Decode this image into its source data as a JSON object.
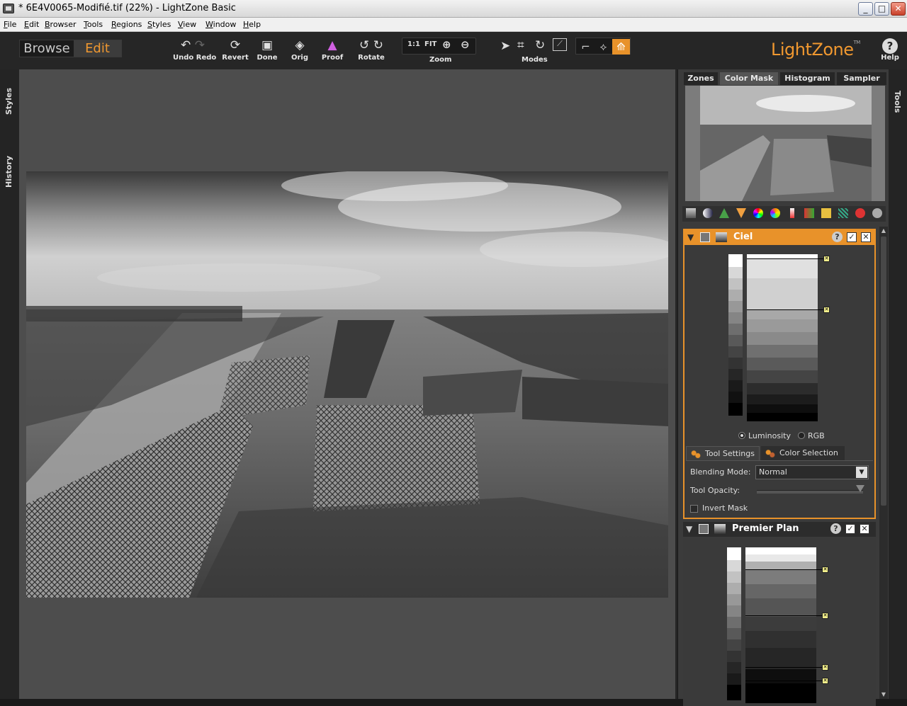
{
  "window": {
    "title": "* 6E4V0065-Modifié.tif (22%) - LightZone Basic",
    "minimize": "_",
    "maximize": "□",
    "close": "✕"
  },
  "menu": [
    "File",
    "Edit",
    "Browser",
    "Tools",
    "Regions",
    "Styles",
    "View",
    "Window",
    "Help"
  ],
  "mode_switch": {
    "browse": "Browse",
    "edit": "Edit",
    "active": "Edit"
  },
  "toolbar": {
    "undo_redo": "Undo Redo",
    "revert": "Revert",
    "done": "Done",
    "orig": "Orig",
    "proof": "Proof",
    "rotate": "Rotate",
    "zoom_label": "Zoom",
    "zoom_1to1": "1:1",
    "zoom_fit": "FIT",
    "modes_label": "Modes"
  },
  "logo": "LightZone",
  "logo_tm": "TM",
  "help_label": "Help",
  "help_glyph": "?",
  "left_tabs": {
    "styles": "Styles",
    "history": "History"
  },
  "right_tab": "Tools",
  "panel_tabs": [
    "Zones",
    "Color Mask",
    "Histogram",
    "Sampler"
  ],
  "active_panel_tab": "Color Mask",
  "tools": [
    {
      "name": "Ciel",
      "active": true,
      "help": "?",
      "enabled": "✓",
      "remove": "✕",
      "mode_options": [
        "Luminosity",
        "RGB"
      ],
      "mode_selected": "Luminosity",
      "subtabs": [
        "Tool Settings",
        "Color Selection"
      ],
      "blending_mode_label": "Blending Mode:",
      "blending_mode_value": "Normal",
      "opacity_label": "Tool Opacity:",
      "opacity_value": 1.0,
      "invert_mask_label": "Invert Mask",
      "invert_mask": false
    },
    {
      "name": "Premier Plan",
      "active": false,
      "help": "?",
      "enabled": "✓",
      "remove": "✕"
    }
  ],
  "colors": {
    "accent": "#e8922a",
    "canvas": "#4d4d4d",
    "panel": "#3b3b3b"
  }
}
